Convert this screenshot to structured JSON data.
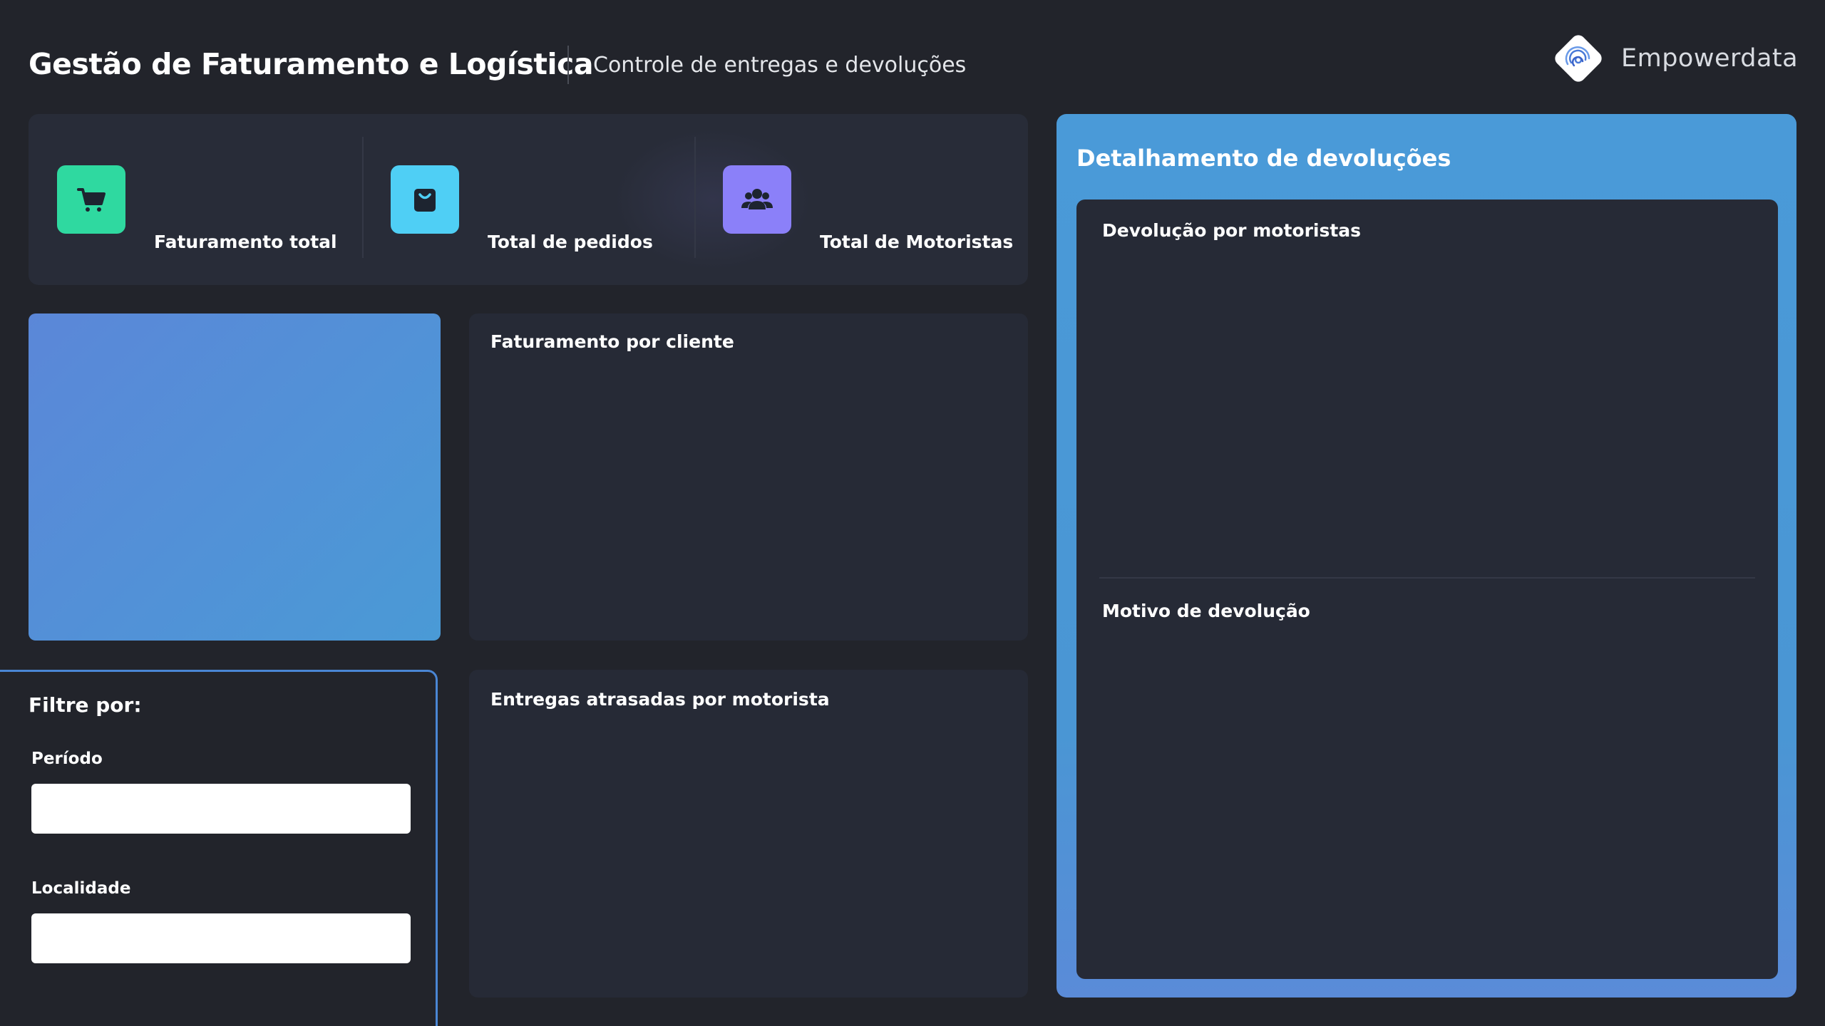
{
  "header": {
    "title": "Gestão de Faturamento e Logística",
    "subtitle": "Controle de entregas e devoluções",
    "brand_name": "Empowerdata",
    "brand_logo_icon": "empowerdata-logo-icon"
  },
  "kpis": [
    {
      "label": "Faturamento total",
      "icon": "shopping-cart-icon",
      "color": "#2fd9a0"
    },
    {
      "label": "Total de pedidos",
      "icon": "shopping-bag-icon",
      "color": "#4fcff5"
    },
    {
      "label": "Total de Motoristas",
      "icon": "users-group-icon",
      "color": "#8b80f9"
    }
  ],
  "cards": {
    "faturamento_cliente": "Faturamento por cliente",
    "entregas_atrasadas": "Entregas atrasadas por motorista"
  },
  "filters": {
    "title": "Filtre por:",
    "periodo_label": "Período",
    "periodo_value": "",
    "localidade_label": "Localidade",
    "localidade_value": ""
  },
  "detail": {
    "title": "Detalhamento de devoluções",
    "devolucao_motoristas": "Devolução por motoristas",
    "motivo_devolucao": "Motivo de devolução"
  },
  "colors": {
    "background": "#22242b",
    "card": "#262a36",
    "accent_blue": "#4a9ad6"
  }
}
